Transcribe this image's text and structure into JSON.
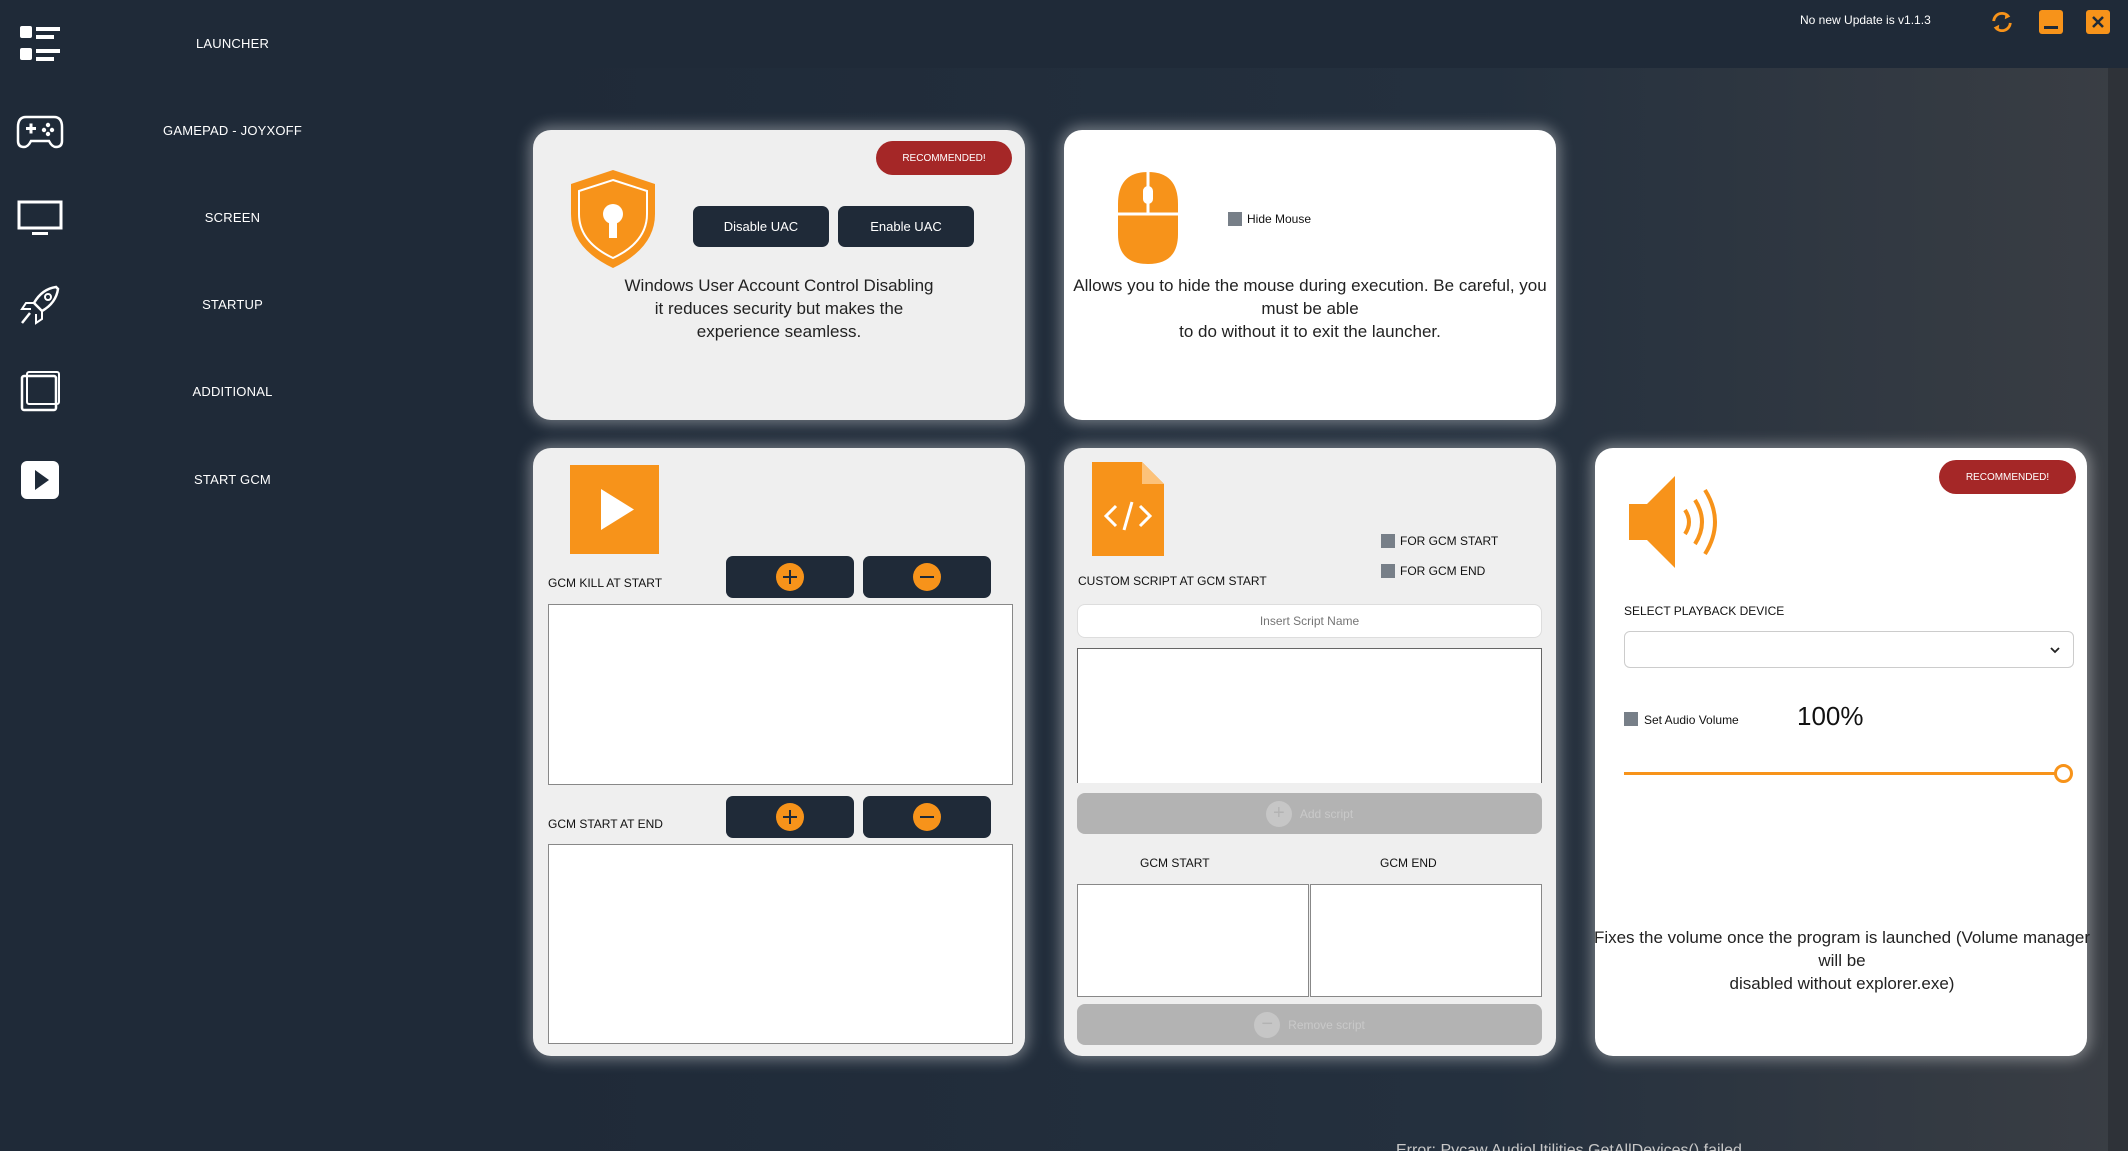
{
  "sidebar": {
    "items": [
      {
        "label": "LAUNCHER",
        "icon": "launcher-list-icon"
      },
      {
        "label": "GAMEPAD - JOYXOFF",
        "icon": "gamepad-icon"
      },
      {
        "label": "SCREEN",
        "icon": "monitor-icon"
      },
      {
        "label": "STARTUP",
        "icon": "rocket-icon"
      },
      {
        "label": "ADDITIONAL",
        "icon": "layers-icon"
      },
      {
        "label": "START GCM",
        "icon": "play-icon"
      }
    ]
  },
  "topbar": {
    "update_status": "No new Update is v1.1.3",
    "refresh_icon": "refresh-icon",
    "minimize_icon": "minimize-icon",
    "close_icon": "close-icon"
  },
  "colors": {
    "background": "#1f2a38",
    "accent": "#f7931a",
    "recommended": "#a52727",
    "button_dark": "#1f2a38"
  },
  "uac_card": {
    "badge": "RECOMMENDED!",
    "icon": "shield-lock-icon",
    "disable_label": "Disable UAC",
    "enable_label": "Enable UAC",
    "description_lines": [
      "Windows User Account Control Disabling",
      "it reduces security but makes the",
      "experience seamless."
    ]
  },
  "mouse_card": {
    "icon": "mouse-icon",
    "checkbox_label": "Hide Mouse",
    "description_lines": [
      "Allows you to hide the mouse during execution. Be careful, you",
      "must be able",
      "to do without it to exit the launcher."
    ]
  },
  "kill_card": {
    "icon": "play-square-icon",
    "kill_at_start_label": "GCM KILL AT START",
    "start_at_end_label": "GCM START AT END",
    "add_icon": "plus-icon",
    "remove_icon": "minus-icon"
  },
  "script_card": {
    "icon": "code-file-icon",
    "label": "CUSTOM SCRIPT AT GCM START",
    "for_start_label": "FOR GCM START",
    "for_end_label": "FOR GCM END",
    "name_placeholder": "Insert Script Name",
    "add_label": "Add script",
    "remove_label": "Remove script",
    "col_start": "GCM START",
    "col_end": "GCM END"
  },
  "audio_card": {
    "badge": "RECOMMENDED!",
    "icon": "speaker-icon",
    "device_label": "SELECT PLAYBACK DEVICE",
    "device_value": "",
    "volume_checkbox_label": "Set Audio Volume",
    "volume_value": "100%",
    "volume_fraction": 1.0,
    "description_lines": [
      "Fixes the volume once the program is launched (Volume manager",
      "will be",
      "disabled without explorer.exe)"
    ]
  },
  "bottom_text": "Error: Pycaw.AudioUtilities.GetAllDevices() failed..."
}
